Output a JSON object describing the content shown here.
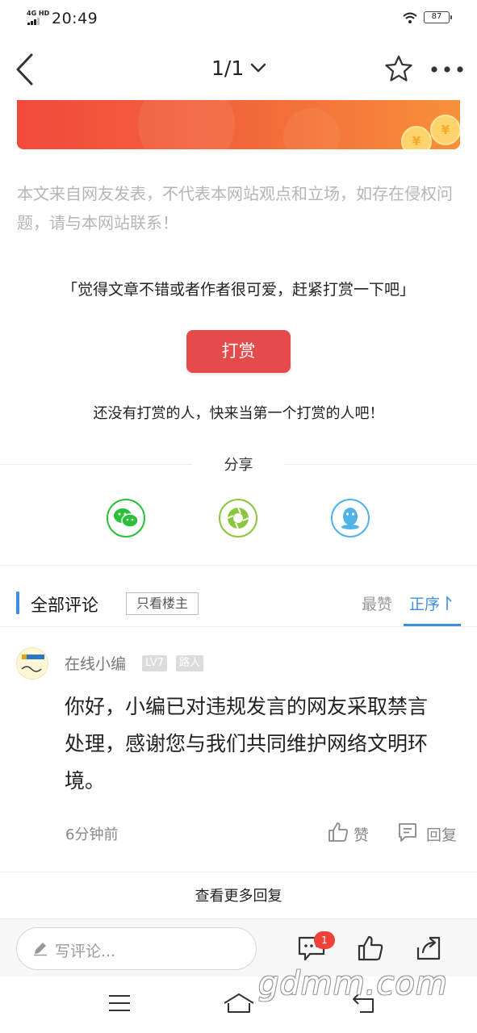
{
  "status_bar": {
    "network": "4G HD",
    "time": "20:49",
    "battery": "87"
  },
  "nav": {
    "page_indicator": "1/1"
  },
  "banner": {
    "coin_symbol": "¥"
  },
  "article": {
    "disclaimer": "本文来自网友发表，不代表本网站观点和立场，如存在侵权问题，请与本网站联系！"
  },
  "reward": {
    "prompt": "「觉得文章不错或者作者很可爱，赶紧打赏一下吧」",
    "button_label": "打赏",
    "empty_text": "还没有打赏的人，快来当第一个打赏的人吧！"
  },
  "share": {
    "title": "分享",
    "targets": [
      "wechat-icon",
      "moments-icon",
      "qq-icon"
    ],
    "colors": {
      "wechat": "#2bc03a",
      "moments": "#8cc63f",
      "qq": "#4fb3e8"
    }
  },
  "comments": {
    "title": "全部评论",
    "only_author": "只看楼主",
    "sort_hot": "最赞",
    "sort_order": "正序",
    "items": [
      {
        "user": "在线小编",
        "level": "LV7",
        "role": "路人",
        "text": "你好，小编已对违规发言的网友采取禁言处理，感谢您与我们共同维护网络文明环境。",
        "time": "6分钟前",
        "like_label": "赞",
        "reply_label": "回复"
      }
    ],
    "more_replies": "查看更多回复"
  },
  "bottom_bar": {
    "input_placeholder": "写评论...",
    "comment_count_badge": "1"
  },
  "watermark": "gdmm.com",
  "accent_color": "#3d8fe0",
  "primary_red": "#e54b4b"
}
